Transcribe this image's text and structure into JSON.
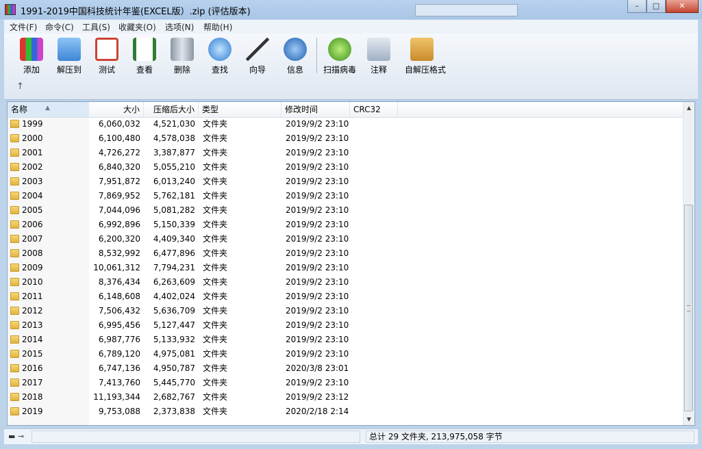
{
  "window": {
    "title": "1991-2019中国科技统计年鉴(EXCEL版）.zip (评估版本)",
    "search_placeholder": "",
    "controls": {
      "minimize": "–",
      "maximize": "□",
      "close": "✕"
    }
  },
  "menu": [
    "文件(F)",
    "命令(C)",
    "工具(S)",
    "收藏夹(O)",
    "选项(N)",
    "帮助(H)"
  ],
  "toolbar": [
    {
      "label": "添加",
      "icon": "add-archive-icon"
    },
    {
      "label": "解压到",
      "icon": "extract-folder-icon"
    },
    {
      "label": "测试",
      "icon": "test-clipboard-icon"
    },
    {
      "label": "查看",
      "icon": "view-book-icon"
    },
    {
      "label": "删除",
      "icon": "trash-icon"
    },
    {
      "label": "查找",
      "icon": "find-magnifier-icon"
    },
    {
      "label": "向导",
      "icon": "wizard-wand-icon"
    },
    {
      "label": "信息",
      "icon": "info-icon"
    },
    {
      "label": "扫描病毒",
      "icon": "virus-scan-icon"
    },
    {
      "label": "注释",
      "icon": "comment-icon"
    },
    {
      "label": "自解压格式",
      "icon": "sfx-box-icon"
    }
  ],
  "up_glyph": "↑",
  "columns": {
    "name": "名称",
    "size": "大小",
    "packed": "压缩后大小",
    "type": "类型",
    "modified": "修改时间",
    "crc": "CRC32",
    "sort_glyph": "▲"
  },
  "files": [
    {
      "name": "1999",
      "size": "6,060,032",
      "packed": "4,521,030",
      "type": "文件夹",
      "modified": "2019/9/2 23:10"
    },
    {
      "name": "2000",
      "size": "6,100,480",
      "packed": "4,578,038",
      "type": "文件夹",
      "modified": "2019/9/2 23:10"
    },
    {
      "name": "2001",
      "size": "4,726,272",
      "packed": "3,387,877",
      "type": "文件夹",
      "modified": "2019/9/2 23:10"
    },
    {
      "name": "2002",
      "size": "6,840,320",
      "packed": "5,055,210",
      "type": "文件夹",
      "modified": "2019/9/2 23:10"
    },
    {
      "name": "2003",
      "size": "7,951,872",
      "packed": "6,013,240",
      "type": "文件夹",
      "modified": "2019/9/2 23:10"
    },
    {
      "name": "2004",
      "size": "7,869,952",
      "packed": "5,762,181",
      "type": "文件夹",
      "modified": "2019/9/2 23:10"
    },
    {
      "name": "2005",
      "size": "7,044,096",
      "packed": "5,081,282",
      "type": "文件夹",
      "modified": "2019/9/2 23:10"
    },
    {
      "name": "2006",
      "size": "6,992,896",
      "packed": "5,150,339",
      "type": "文件夹",
      "modified": "2019/9/2 23:10"
    },
    {
      "name": "2007",
      "size": "6,200,320",
      "packed": "4,409,340",
      "type": "文件夹",
      "modified": "2019/9/2 23:10"
    },
    {
      "name": "2008",
      "size": "8,532,992",
      "packed": "6,477,896",
      "type": "文件夹",
      "modified": "2019/9/2 23:10"
    },
    {
      "name": "2009",
      "size": "10,061,312",
      "packed": "7,794,231",
      "type": "文件夹",
      "modified": "2019/9/2 23:10"
    },
    {
      "name": "2010",
      "size": "8,376,434",
      "packed": "6,263,609",
      "type": "文件夹",
      "modified": "2019/9/2 23:10"
    },
    {
      "name": "2011",
      "size": "6,148,608",
      "packed": "4,402,024",
      "type": "文件夹",
      "modified": "2019/9/2 23:10"
    },
    {
      "name": "2012",
      "size": "7,506,432",
      "packed": "5,636,709",
      "type": "文件夹",
      "modified": "2019/9/2 23:10"
    },
    {
      "name": "2013",
      "size": "6,995,456",
      "packed": "5,127,447",
      "type": "文件夹",
      "modified": "2019/9/2 23:10"
    },
    {
      "name": "2014",
      "size": "6,987,776",
      "packed": "5,133,932",
      "type": "文件夹",
      "modified": "2019/9/2 23:10"
    },
    {
      "name": "2015",
      "size": "6,789,120",
      "packed": "4,975,081",
      "type": "文件夹",
      "modified": "2019/9/2 23:10"
    },
    {
      "name": "2016",
      "size": "6,747,136",
      "packed": "4,950,787",
      "type": "文件夹",
      "modified": "2020/3/8 23:01"
    },
    {
      "name": "2017",
      "size": "7,413,760",
      "packed": "5,445,770",
      "type": "文件夹",
      "modified": "2019/9/2 23:10"
    },
    {
      "name": "2018",
      "size": "11,193,344",
      "packed": "2,682,767",
      "type": "文件夹",
      "modified": "2019/9/2 23:12"
    },
    {
      "name": "2019",
      "size": "9,753,088",
      "packed": "2,373,838",
      "type": "文件夹",
      "modified": "2020/2/18 2:14"
    }
  ],
  "scrollbar": {
    "up": "▲",
    "down": "▼"
  },
  "status": {
    "icons": "▬ ⊸",
    "left": "",
    "right": "总计 29 文件夹, 213,975,058 字节"
  }
}
